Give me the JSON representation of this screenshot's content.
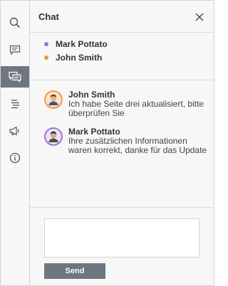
{
  "colors": {
    "accent_grey": "#6e7680",
    "mark_dot": "#9b6fd6",
    "john_dot": "#f0953a",
    "john_ring": "#f0953a",
    "mark_ring": "#9b6fd6"
  },
  "rail": {
    "items": [
      {
        "icon": "search-icon"
      },
      {
        "icon": "comment-icon"
      },
      {
        "icon": "chat-icon",
        "active": true
      },
      {
        "icon": "text-align-icon"
      },
      {
        "icon": "megaphone-icon"
      },
      {
        "icon": "info-icon"
      }
    ]
  },
  "header": {
    "title": "Chat",
    "close_icon": "close-icon"
  },
  "participants": [
    {
      "name": "Mark Pottato",
      "color": "#9b6fd6"
    },
    {
      "name": "John Smith",
      "color": "#f0953a"
    }
  ],
  "messages": [
    {
      "author": "John Smith",
      "text": "Ich habe Seite drei aktualisiert, bitte überprüfen Sie"
    },
    {
      "author": "Mark Pottato",
      "text": "Ihre zusätzlichen Informationen waren korrekt, danke für das Update"
    }
  ],
  "composer": {
    "placeholder": "",
    "value": "",
    "send_label": "Send"
  }
}
